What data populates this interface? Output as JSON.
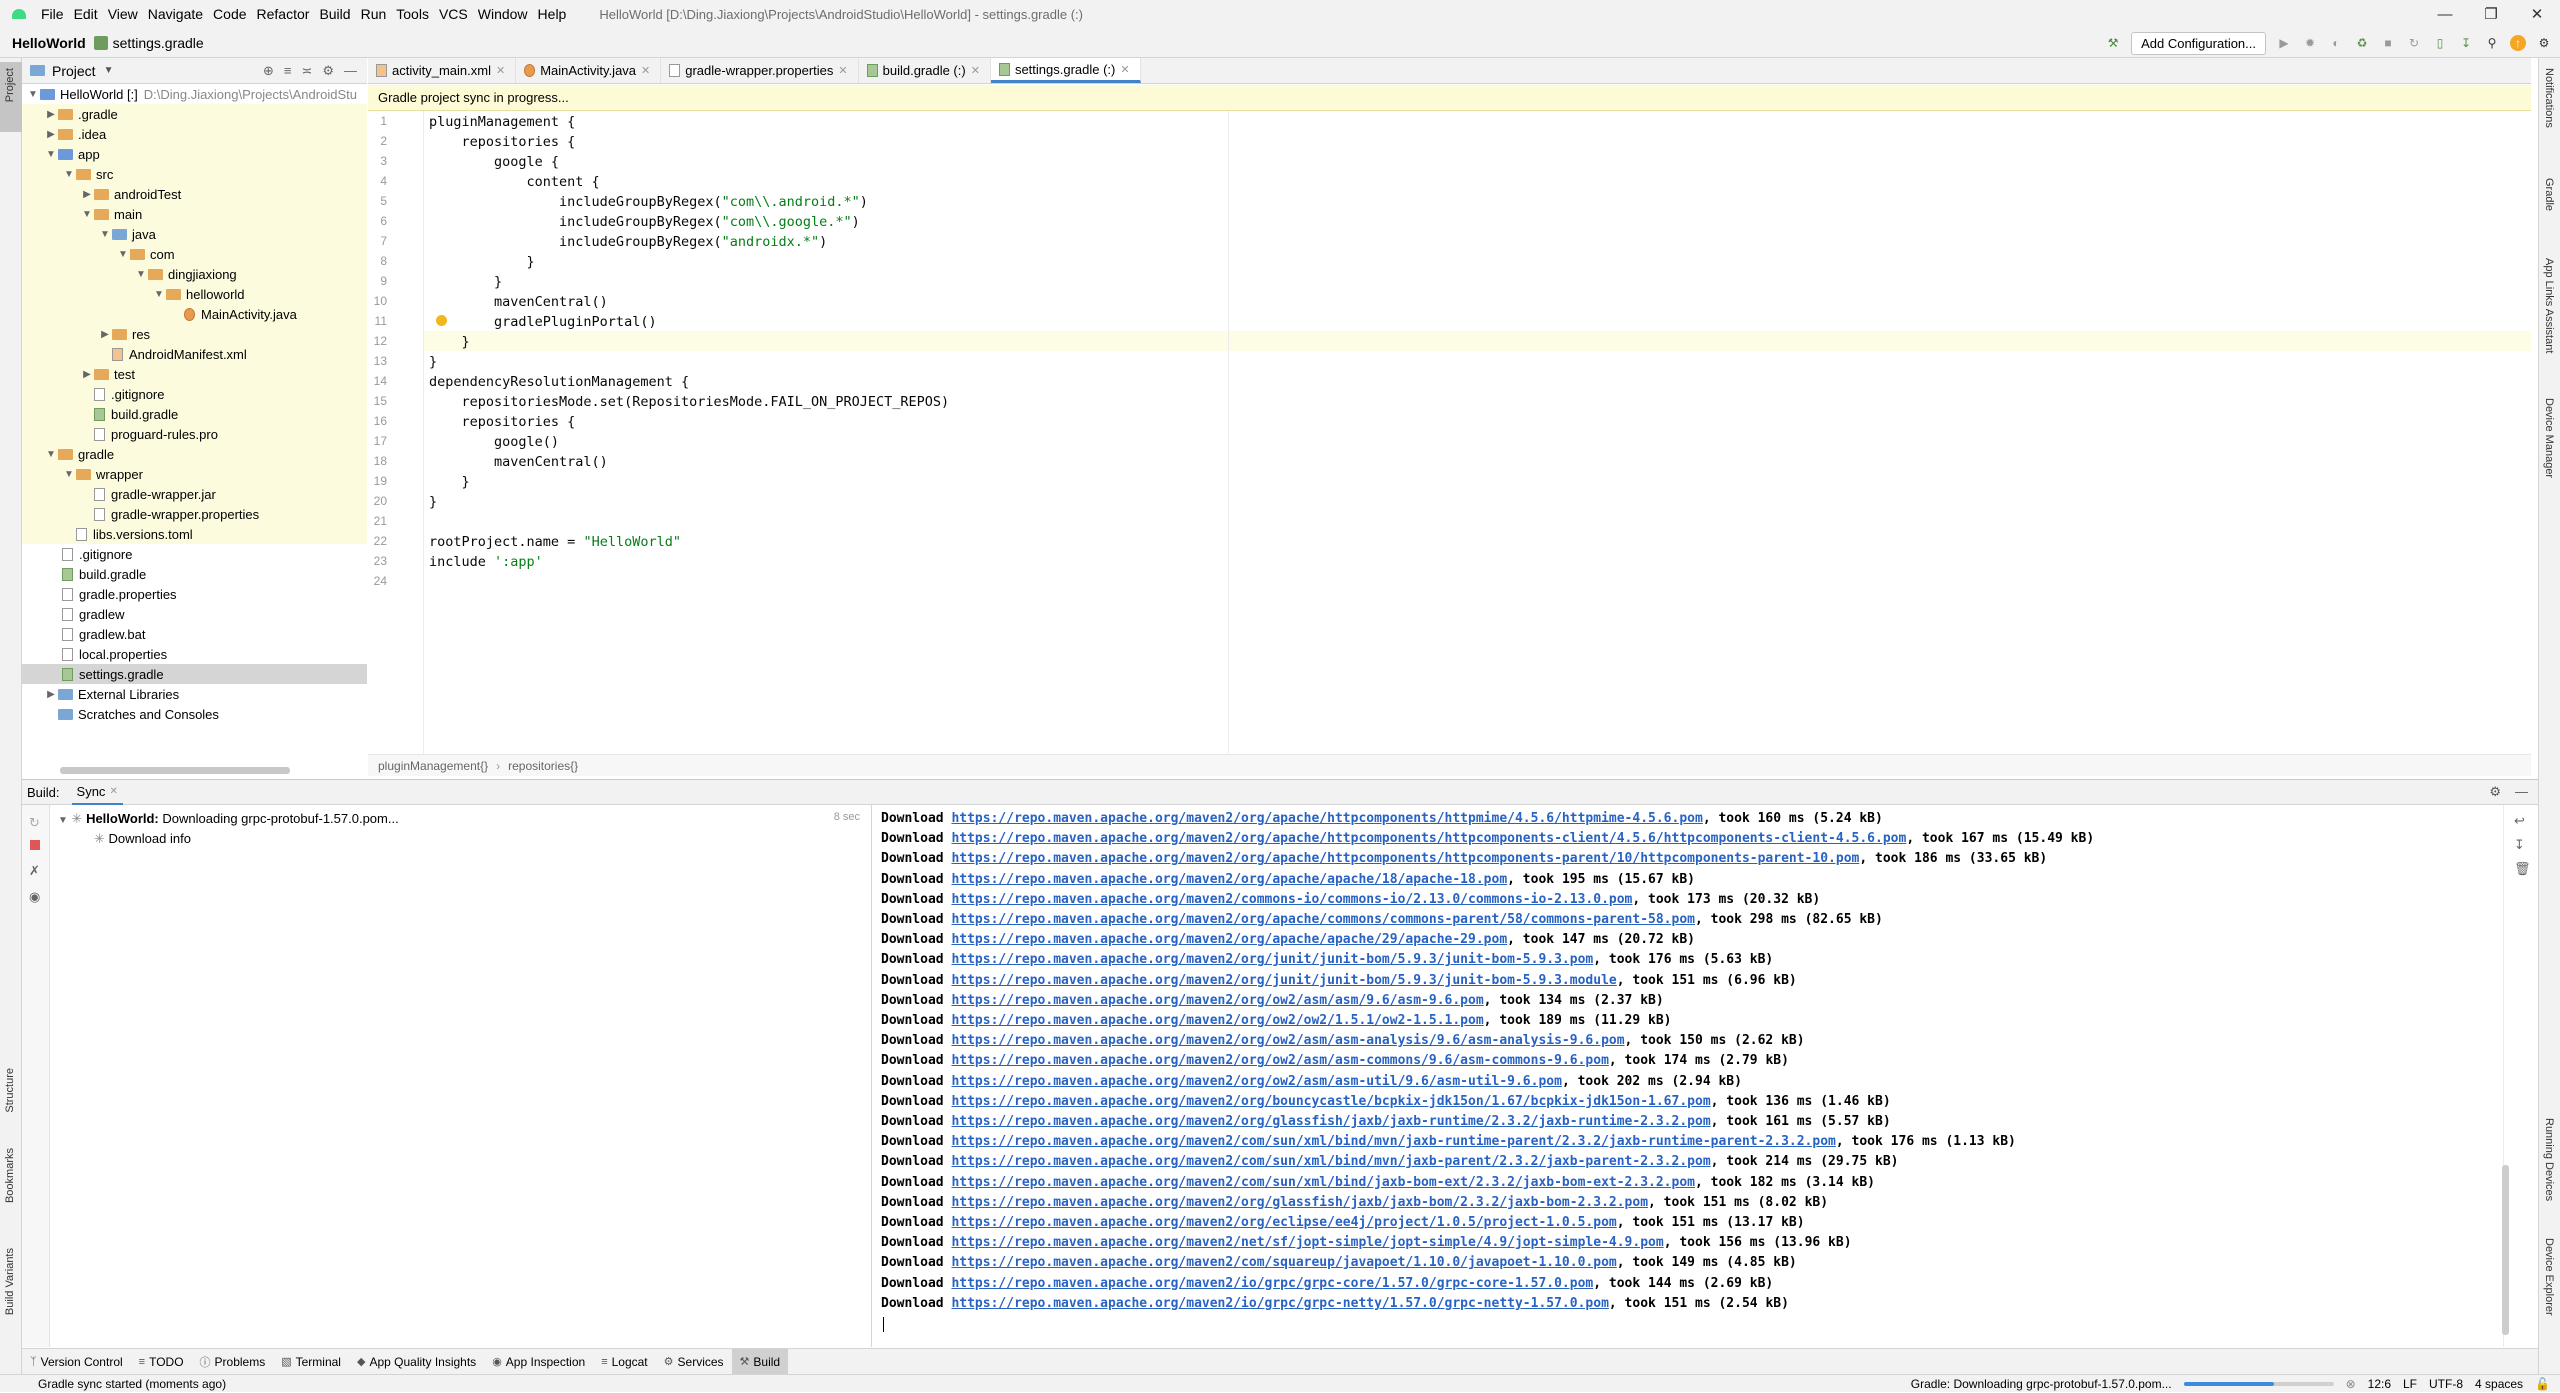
{
  "menu": [
    "File",
    "Edit",
    "View",
    "Navigate",
    "Code",
    "Refactor",
    "Build",
    "Run",
    "Tools",
    "VCS",
    "Window",
    "Help"
  ],
  "window_title": "HelloWorld [D:\\Ding.Jiaxiong\\Projects\\AndroidStudio\\HelloWorld] - settings.gradle (:)",
  "nav": {
    "project": "HelloWorld",
    "file": "settings.gradle",
    "add_config": "Add Configuration..."
  },
  "project_panel": {
    "title": "Project",
    "root": "HelloWorld [:]",
    "root_path": "D:\\Ding.Jiaxiong\\Projects\\AndroidStu",
    "tree": [
      ".gradle",
      ".idea",
      "app",
      "src",
      "androidTest",
      "main",
      "java",
      "com",
      "dingjiaxiong",
      "helloworld",
      "MainActivity.java",
      "res",
      "AndroidManifest.xml",
      "test",
      ".gitignore",
      "build.gradle",
      "proguard-rules.pro",
      "gradle",
      "wrapper",
      "gradle-wrapper.jar",
      "gradle-wrapper.properties",
      "libs.versions.toml",
      ".gitignore",
      "build.gradle",
      "gradle.properties",
      "gradlew",
      "gradlew.bat",
      "local.properties",
      "settings.gradle",
      "External Libraries",
      "Scratches and Consoles"
    ]
  },
  "tabs": [
    "activity_main.xml",
    "MainActivity.java",
    "gradle-wrapper.properties",
    "build.gradle (:)",
    "settings.gradle (:)"
  ],
  "sync_banner": "Gradle project sync in progress...",
  "code": [
    "pluginManagement {",
    "    repositories {",
    "        google {",
    "            content {",
    "                includeGroupByRegex(\"com\\\\.android.*\")",
    "                includeGroupByRegex(\"com\\\\.google.*\")",
    "                includeGroupByRegex(\"androidx.*\")",
    "            }",
    "        }",
    "        mavenCentral()",
    "        gradlePluginPortal()",
    "    }",
    "}",
    "dependencyResolutionManagement {",
    "    repositoriesMode.set(RepositoriesMode.FAIL_ON_PROJECT_REPOS)",
    "    repositories {",
    "        google()",
    "        mavenCentral()",
    "    }",
    "}",
    "",
    "rootProject.name = \"HelloWorld\"",
    "include ':app'",
    ""
  ],
  "breadcrumb": [
    "pluginManagement{}",
    "repositories{}"
  ],
  "build": {
    "label": "Build:",
    "tab": "Sync",
    "task_name": "HelloWorld:",
    "task_status": "Downloading grpc-protobuf-1.57.0.pom...",
    "elapsed": "8 sec",
    "child": "Download info"
  },
  "console": [
    {
      "url": "https://repo.maven.apache.org/maven2/org/apache/httpcomponents/httpmime/4.5.6/httpmime-4.5.6.pom",
      "stat": ", took 160 ms (5.24 kB)"
    },
    {
      "url": "https://repo.maven.apache.org/maven2/org/apache/httpcomponents/httpcomponents-client/4.5.6/httpcomponents-client-4.5.6.pom",
      "stat": ", took 167 ms (15.49 kB)"
    },
    {
      "url": "https://repo.maven.apache.org/maven2/org/apache/httpcomponents/httpcomponents-parent/10/httpcomponents-parent-10.pom",
      "stat": ", took 186 ms (33.65 kB)"
    },
    {
      "url": "https://repo.maven.apache.org/maven2/org/apache/apache/18/apache-18.pom",
      "stat": ", took 195 ms (15.67 kB)"
    },
    {
      "url": "https://repo.maven.apache.org/maven2/commons-io/commons-io/2.13.0/commons-io-2.13.0.pom",
      "stat": ", took 173 ms (20.32 kB)"
    },
    {
      "url": "https://repo.maven.apache.org/maven2/org/apache/commons/commons-parent/58/commons-parent-58.pom",
      "stat": ", took 298 ms (82.65 kB)"
    },
    {
      "url": "https://repo.maven.apache.org/maven2/org/apache/apache/29/apache-29.pom",
      "stat": ", took 147 ms (20.72 kB)"
    },
    {
      "url": "https://repo.maven.apache.org/maven2/org/junit/junit-bom/5.9.3/junit-bom-5.9.3.pom",
      "stat": ", took 176 ms (5.63 kB)"
    },
    {
      "url": "https://repo.maven.apache.org/maven2/org/junit/junit-bom/5.9.3/junit-bom-5.9.3.module",
      "stat": ", took 151 ms (6.96 kB)"
    },
    {
      "url": "https://repo.maven.apache.org/maven2/org/ow2/asm/asm/9.6/asm-9.6.pom",
      "stat": ", took 134 ms (2.37 kB)"
    },
    {
      "url": "https://repo.maven.apache.org/maven2/org/ow2/ow2/1.5.1/ow2-1.5.1.pom",
      "stat": ", took 189 ms (11.29 kB)"
    },
    {
      "url": "https://repo.maven.apache.org/maven2/org/ow2/asm/asm-analysis/9.6/asm-analysis-9.6.pom",
      "stat": ", took 150 ms (2.62 kB)"
    },
    {
      "url": "https://repo.maven.apache.org/maven2/org/ow2/asm/asm-commons/9.6/asm-commons-9.6.pom",
      "stat": ", took 174 ms (2.79 kB)"
    },
    {
      "url": "https://repo.maven.apache.org/maven2/org/ow2/asm/asm-util/9.6/asm-util-9.6.pom",
      "stat": ", took 202 ms (2.94 kB)"
    },
    {
      "url": "https://repo.maven.apache.org/maven2/org/bouncycastle/bcpkix-jdk15on/1.67/bcpkix-jdk15on-1.67.pom",
      "stat": ", took 136 ms (1.46 kB)"
    },
    {
      "url": "https://repo.maven.apache.org/maven2/org/glassfish/jaxb/jaxb-runtime/2.3.2/jaxb-runtime-2.3.2.pom",
      "stat": ", took 161 ms (5.57 kB)"
    },
    {
      "url": "https://repo.maven.apache.org/maven2/com/sun/xml/bind/mvn/jaxb-runtime-parent/2.3.2/jaxb-runtime-parent-2.3.2.pom",
      "stat": ", took 176 ms (1.13 kB)"
    },
    {
      "url": "https://repo.maven.apache.org/maven2/com/sun/xml/bind/mvn/jaxb-parent/2.3.2/jaxb-parent-2.3.2.pom",
      "stat": ", took 214 ms (29.75 kB)"
    },
    {
      "url": "https://repo.maven.apache.org/maven2/com/sun/xml/bind/jaxb-bom-ext/2.3.2/jaxb-bom-ext-2.3.2.pom",
      "stat": ", took 182 ms (3.14 kB)"
    },
    {
      "url": "https://repo.maven.apache.org/maven2/org/glassfish/jaxb/jaxb-bom/2.3.2/jaxb-bom-2.3.2.pom",
      "stat": ", took 151 ms (8.02 kB)"
    },
    {
      "url": "https://repo.maven.apache.org/maven2/org/eclipse/ee4j/project/1.0.5/project-1.0.5.pom",
      "stat": ", took 151 ms (13.17 kB)"
    },
    {
      "url": "https://repo.maven.apache.org/maven2/net/sf/jopt-simple/jopt-simple/4.9/jopt-simple-4.9.pom",
      "stat": ", took 156 ms (13.96 kB)"
    },
    {
      "url": "https://repo.maven.apache.org/maven2/com/squareup/javapoet/1.10.0/javapoet-1.10.0.pom",
      "stat": ", took 149 ms (4.85 kB)"
    },
    {
      "url": "https://repo.maven.apache.org/maven2/io/grpc/grpc-core/1.57.0/grpc-core-1.57.0.pom",
      "stat": ", took 144 ms (2.69 kB)"
    },
    {
      "url": "https://repo.maven.apache.org/maven2/io/grpc/grpc-netty/1.57.0/grpc-netty-1.57.0.pom",
      "stat": ", took 151 ms (2.54 kB)"
    }
  ],
  "console_prefix": "Download ",
  "bottom_tabs": [
    "Version Control",
    "TODO",
    "Problems",
    "Terminal",
    "App Quality Insights",
    "App Inspection",
    "Logcat",
    "Services",
    "Build"
  ],
  "left_strip": [
    "Project",
    "Structure",
    "Bookmarks",
    "Build Variants"
  ],
  "right_strip": [
    "Notifications",
    "Gradle",
    "App Links Assistant",
    "Device Manager",
    "Running Devices",
    "Device Explorer"
  ],
  "status": {
    "left": "Gradle sync started (moments ago)",
    "progress_text": "Gradle: Downloading grpc-protobuf-1.57.0.pom...",
    "position": "12:6",
    "line_sep": "LF",
    "encoding": "UTF-8",
    "indent": "4 spaces"
  }
}
